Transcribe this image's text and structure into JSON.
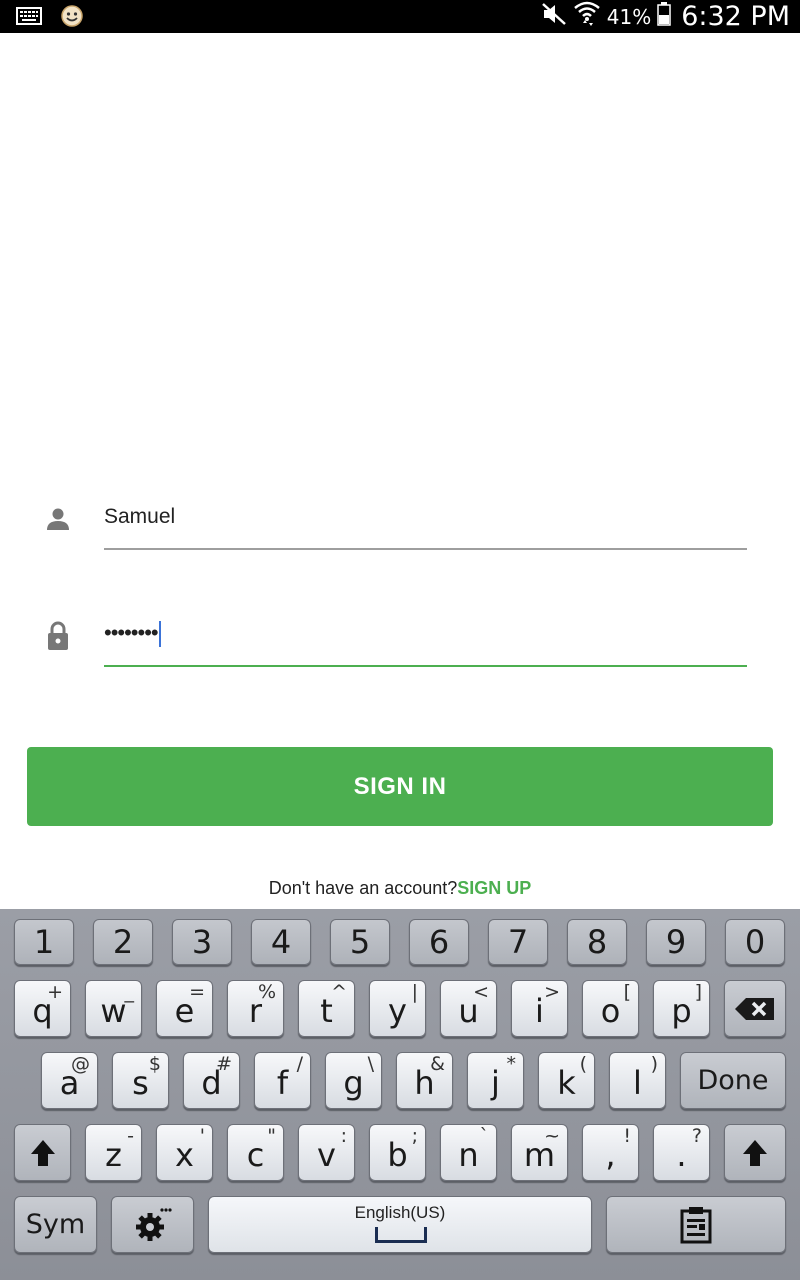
{
  "status_bar": {
    "battery_percent": "41%",
    "time": "6:32 PM",
    "icons": [
      "keyboard-icon",
      "app-notification-icon",
      "mute-icon",
      "wifi-icon",
      "battery-icon"
    ]
  },
  "login": {
    "username_value": "Samuel",
    "password_masked": "••••••••",
    "signin_label": "SIGN IN",
    "signup_prompt": "Don't have an account?",
    "signup_link": "SIGN UP"
  },
  "colors": {
    "accent": "#4caf50",
    "cursor": "#3b73d8"
  },
  "keyboard": {
    "numbers": [
      "1",
      "2",
      "3",
      "4",
      "5",
      "6",
      "7",
      "8",
      "9",
      "0"
    ],
    "row1": [
      {
        "main": "q",
        "sec": "+"
      },
      {
        "main": "w",
        "sec": "_"
      },
      {
        "main": "e",
        "sec": "="
      },
      {
        "main": "r",
        "sec": "%"
      },
      {
        "main": "t",
        "sec": "^"
      },
      {
        "main": "y",
        "sec": "|"
      },
      {
        "main": "u",
        "sec": "<"
      },
      {
        "main": "i",
        "sec": ">"
      },
      {
        "main": "o",
        "sec": "["
      },
      {
        "main": "p",
        "sec": "]"
      }
    ],
    "row2": [
      {
        "main": "a",
        "sec": "@"
      },
      {
        "main": "s",
        "sec": "$"
      },
      {
        "main": "d",
        "sec": "#"
      },
      {
        "main": "f",
        "sec": "/"
      },
      {
        "main": "g",
        "sec": "\\"
      },
      {
        "main": "h",
        "sec": "&"
      },
      {
        "main": "j",
        "sec": "*"
      },
      {
        "main": "k",
        "sec": "("
      },
      {
        "main": "l",
        "sec": ")"
      }
    ],
    "row3": [
      {
        "main": "z",
        "sec": "-"
      },
      {
        "main": "x",
        "sec": "'"
      },
      {
        "main": "c",
        "sec": "\""
      },
      {
        "main": "v",
        "sec": ":"
      },
      {
        "main": "b",
        "sec": ";"
      },
      {
        "main": "n",
        "sec": "`"
      },
      {
        "main": "m",
        "sec": "~"
      },
      {
        "main": ",",
        "sec": "!"
      },
      {
        "main": ".",
        "sec": "?"
      }
    ],
    "done_label": "Done",
    "sym_label": "Sym",
    "language_label": "English(US)"
  }
}
